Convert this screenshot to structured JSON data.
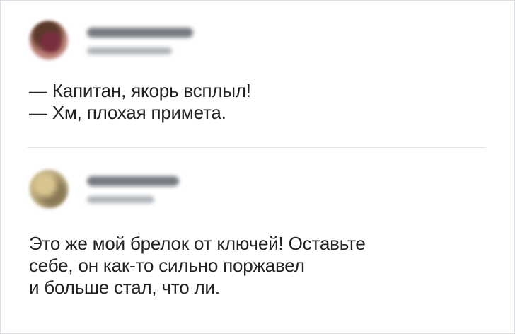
{
  "posts": [
    {
      "avatar_icon": "blurred-user-avatar",
      "lines": [
        "— Капитан, якорь всплыл!",
        "— Хм, плохая примета."
      ]
    },
    {
      "avatar_icon": "blurred-user-avatar",
      "lines": [
        "Это же мой брелок от ключей! Оставьте",
        "себе, он как-то сильно поржавел",
        "и больше стал, что ли."
      ]
    }
  ],
  "colors": {
    "text": "#222222",
    "divider": "#dde3ea",
    "border": "#d7dee6",
    "background": "#ffffff"
  }
}
